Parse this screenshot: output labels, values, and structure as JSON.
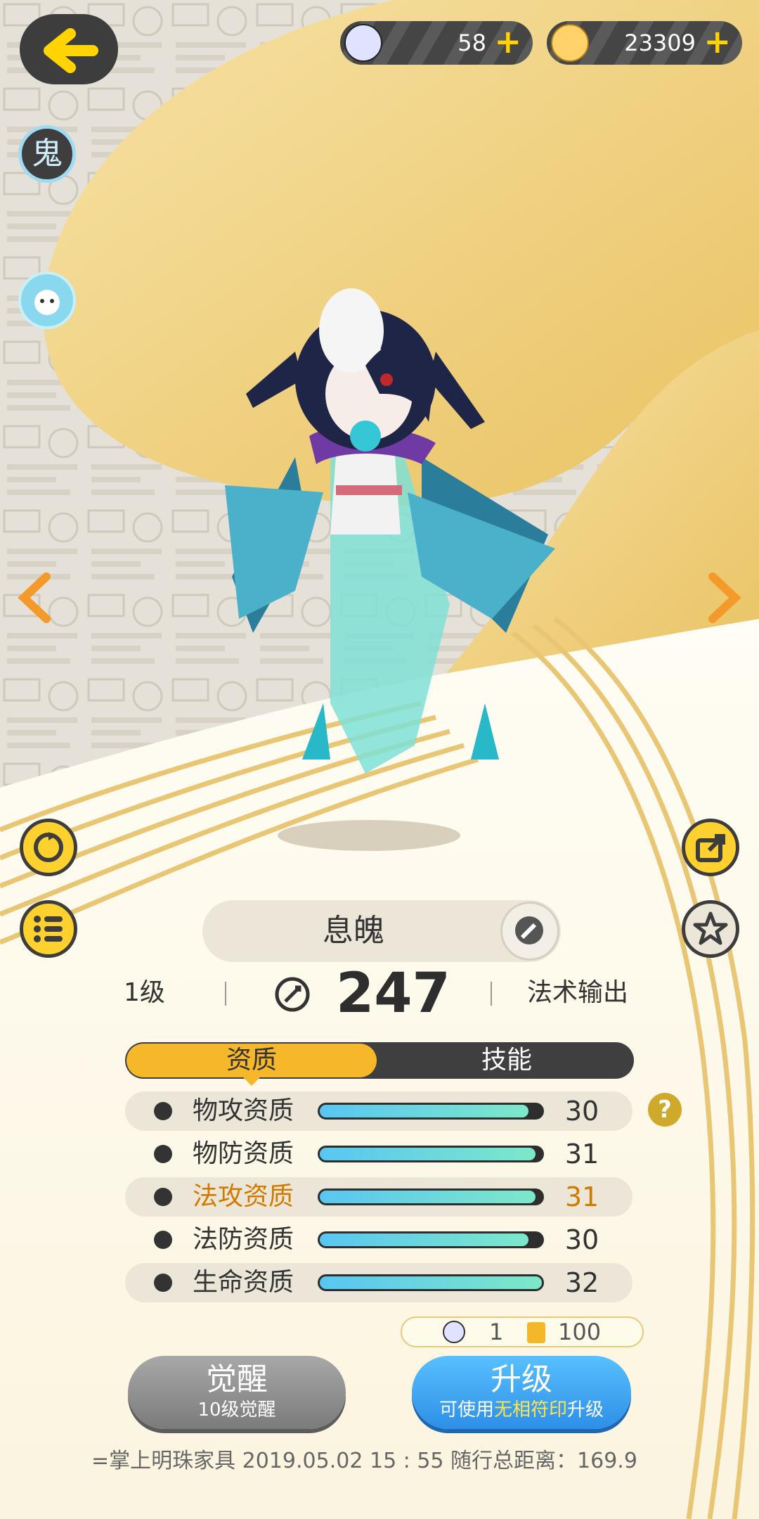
{
  "currencies": [
    {
      "name": "soul-coin",
      "value": "58"
    },
    {
      "name": "crystal",
      "value": "23309"
    }
  ],
  "badge_left": "鬼",
  "pet_name": "息魄",
  "level": "1级",
  "power": "247",
  "role": "法术输出",
  "tabs": [
    "资质",
    "技能"
  ],
  "stats": [
    {
      "label": "物攻资质",
      "value": "30",
      "fill": 0.94,
      "highlight": false,
      "icon": "crossed-swords-icon"
    },
    {
      "label": "物防资质",
      "value": "31",
      "fill": 0.97,
      "highlight": false,
      "icon": "shield-icon"
    },
    {
      "label": "法攻资质",
      "value": "31",
      "fill": 0.97,
      "highlight": true,
      "icon": "yin-yang-icon"
    },
    {
      "label": "法防资质",
      "value": "30",
      "fill": 0.94,
      "highlight": false,
      "icon": "magic-shield-icon"
    },
    {
      "label": "生命资质",
      "value": "32",
      "fill": 1.0,
      "highlight": false,
      "icon": "heart-icon"
    }
  ],
  "cost": {
    "soul": "1",
    "crystal": "100"
  },
  "awaken": {
    "title": "觉醒",
    "sub": "10级觉醒"
  },
  "upgrade": {
    "title": "升级",
    "sub_a": "可使用",
    "sub_highlight": "无相符印",
    "sub_b": "升级"
  },
  "footer": "=掌上明珠家具  2019.05.02    15 : 55    随行总距离：169.9",
  "colors": {
    "accent": "#f6b72a",
    "highlight_text": "#d27a00",
    "blue_button": "#3aa0f0",
    "grey_button": "#8a8a8a"
  }
}
